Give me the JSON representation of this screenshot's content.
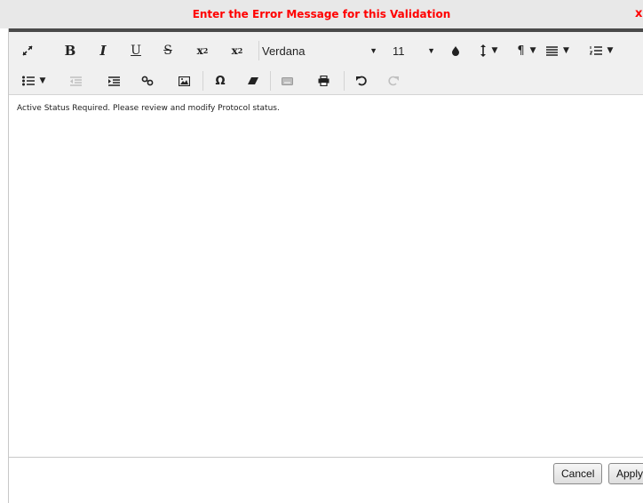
{
  "dialog": {
    "title": "Enter the Error Message for this Validation",
    "close_label": "x",
    "title_color": "#ff0000"
  },
  "toolbar": {
    "bold": "B",
    "italic": "I",
    "underline": "U",
    "strikethrough": "S",
    "subscript_base": "x",
    "subscript_mark": "2",
    "superscript_base": "x",
    "superscript_mark": "2",
    "font_family": "Verdana",
    "font_size": "11",
    "paragraph": "¶",
    "special_char": "Ω",
    "icons": [
      "fullscreen-icon",
      "bold-icon",
      "italic-icon",
      "underline-icon",
      "strikethrough-icon",
      "subscript-icon",
      "superscript-icon",
      "text-color-icon",
      "line-height-icon",
      "paragraph-format-icon",
      "align-icon",
      "ordered-list-icon",
      "unordered-list-icon",
      "outdent-icon",
      "indent-icon",
      "link-icon",
      "image-icon",
      "special-character-icon",
      "clear-formatting-icon",
      "keyboard-icon",
      "print-icon",
      "undo-icon",
      "redo-icon"
    ]
  },
  "editor": {
    "content": "Active Status Required. Please review and modify Protocol status."
  },
  "footer": {
    "cancel_label": "Cancel",
    "apply_label": "Apply"
  }
}
